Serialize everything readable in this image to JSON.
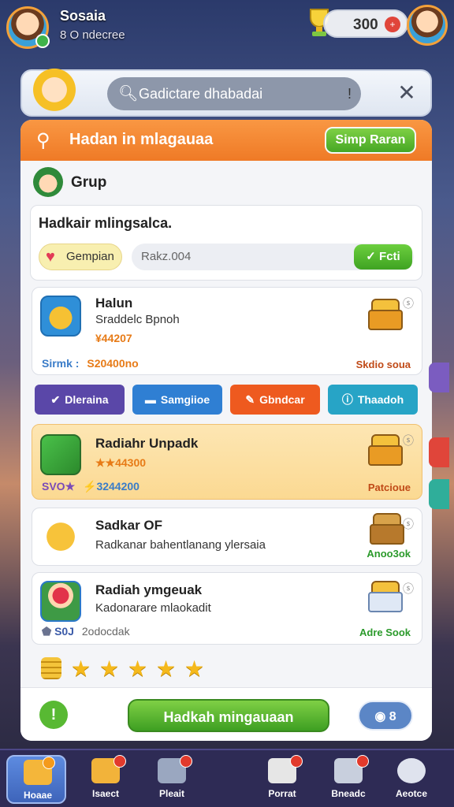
{
  "player": {
    "name": "Sosaia",
    "subtitle": "8 O ndecree"
  },
  "currency": {
    "value": "300"
  },
  "search": {
    "placeholder": "Gadictare dhabadai",
    "close_label": "✕"
  },
  "header": {
    "title": "Hadan in mlagauaa",
    "button_label": "Simp Raran"
  },
  "group": {
    "label": "Grup"
  },
  "message": {
    "text": "Hadkair mlingsalca.",
    "campaign_label": "Gempian",
    "input_value": "Rakz.004",
    "ok_label": "Fcti"
  },
  "items": [
    {
      "title": "Halun",
      "subtitle": "Sraddelc Bpnoh",
      "price": "¥44207",
      "foot_label": "Sirmk :",
      "foot_value": "S20400no",
      "right_label": "Skdio soua"
    },
    {
      "title": "Radiahr Unpadk",
      "price": "★★44300",
      "foot_label": "SVO★",
      "foot_value": "⚡3244200",
      "right_label": "Patcioue"
    },
    {
      "title": "Sadkar OF",
      "subtitle": "Radkanar bahentlanang ylersaia",
      "right_label": "Anoo3ok"
    },
    {
      "title": "Radiah ymgeuak",
      "subtitle": "Kadonarare mlaokadit",
      "foot_label": "S0J",
      "foot_value": "2odocdak",
      "right_label": "Adre Sook"
    }
  ],
  "categories": [
    {
      "label": "Dleraina",
      "icon": "check-icon"
    },
    {
      "label": "Samgiioe",
      "icon": "card-icon"
    },
    {
      "label": "Gbndcar",
      "icon": "pencil-icon"
    },
    {
      "label": "Thaadoh",
      "icon": "info-icon"
    }
  ],
  "footer": {
    "info_label": "!",
    "action_label": "Hadkah mingauaan",
    "count_label": "8"
  },
  "nav": [
    {
      "label": "Hoaae",
      "icon": "home-icon",
      "active": true
    },
    {
      "label": "Isaect",
      "icon": "shop-icon"
    },
    {
      "label": "Pleait",
      "icon": "robot-icon"
    },
    {
      "label": "Porrat",
      "icon": "document-icon"
    },
    {
      "label": "Bneadc",
      "icon": "chat-icon"
    },
    {
      "label": "Aeotce",
      "icon": "grid-icon"
    }
  ],
  "colors": {
    "header_orange": "#ef7a26",
    "action_green": "#45a724",
    "highlight_bg": "#fbd992",
    "nav_bg": "#2e2b55"
  }
}
